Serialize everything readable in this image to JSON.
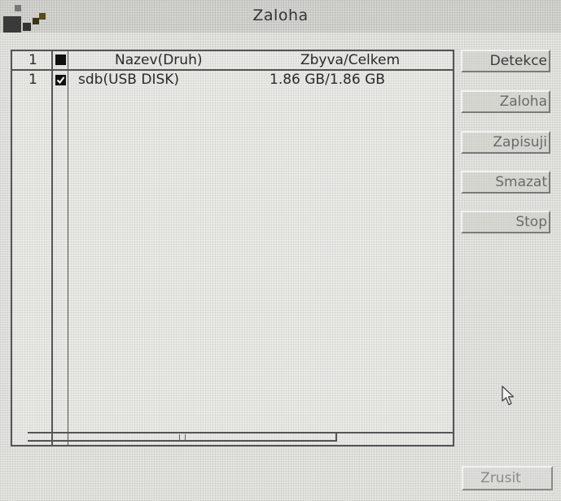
{
  "window": {
    "title": "Zaloha"
  },
  "table": {
    "header": {
      "index": "1",
      "name": "Nazev(Druh)",
      "space": "Zbyva/Celkem"
    },
    "rows": [
      {
        "index": "1",
        "checked": true,
        "name": "sdb(USB DISK)",
        "space": "1.86 GB/1.86 GB"
      }
    ]
  },
  "actions": {
    "detect_label": "Detekce",
    "backup_label": "Zaloha",
    "write_label": "Zapisuji",
    "delete_label": "Smazat",
    "stop_label": "Stop"
  },
  "footer": {
    "cancel_label": "Zrusit"
  },
  "icons": {
    "logo": "app-logo-icon",
    "header_checkbox": "checkbox-icon",
    "row_checkbox": "checkbox-checked-icon",
    "cursor": "mouse-pointer-icon"
  },
  "colors": {
    "background": "#e4e4e0",
    "border": "#555555",
    "text": "#2a2a2a",
    "disabled_text": "#8a8a8a"
  }
}
